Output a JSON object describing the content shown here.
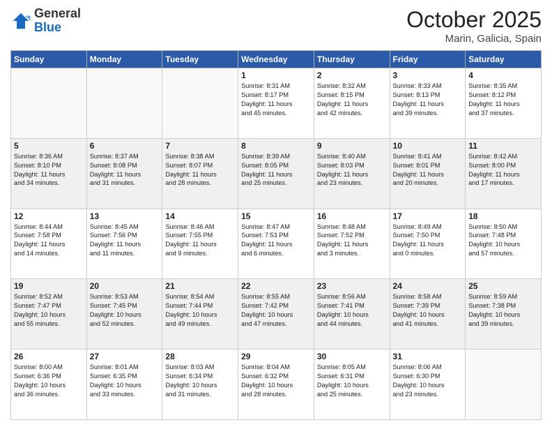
{
  "header": {
    "logo_general": "General",
    "logo_blue": "Blue",
    "month": "October 2025",
    "location": "Marin, Galicia, Spain"
  },
  "days_of_week": [
    "Sunday",
    "Monday",
    "Tuesday",
    "Wednesday",
    "Thursday",
    "Friday",
    "Saturday"
  ],
  "weeks": [
    [
      {
        "day": "",
        "info": []
      },
      {
        "day": "",
        "info": []
      },
      {
        "day": "",
        "info": []
      },
      {
        "day": "1",
        "info": [
          "Sunrise: 8:31 AM",
          "Sunset: 8:17 PM",
          "Daylight: 11 hours",
          "and 45 minutes."
        ]
      },
      {
        "day": "2",
        "info": [
          "Sunrise: 8:32 AM",
          "Sunset: 8:15 PM",
          "Daylight: 11 hours",
          "and 42 minutes."
        ]
      },
      {
        "day": "3",
        "info": [
          "Sunrise: 8:33 AM",
          "Sunset: 8:13 PM",
          "Daylight: 11 hours",
          "and 39 minutes."
        ]
      },
      {
        "day": "4",
        "info": [
          "Sunrise: 8:35 AM",
          "Sunset: 8:12 PM",
          "Daylight: 11 hours",
          "and 37 minutes."
        ]
      }
    ],
    [
      {
        "day": "5",
        "info": [
          "Sunrise: 8:36 AM",
          "Sunset: 8:10 PM",
          "Daylight: 11 hours",
          "and 34 minutes."
        ]
      },
      {
        "day": "6",
        "info": [
          "Sunrise: 8:37 AM",
          "Sunset: 8:08 PM",
          "Daylight: 11 hours",
          "and 31 minutes."
        ]
      },
      {
        "day": "7",
        "info": [
          "Sunrise: 8:38 AM",
          "Sunset: 8:07 PM",
          "Daylight: 11 hours",
          "and 28 minutes."
        ]
      },
      {
        "day": "8",
        "info": [
          "Sunrise: 8:39 AM",
          "Sunset: 8:05 PM",
          "Daylight: 11 hours",
          "and 25 minutes."
        ]
      },
      {
        "day": "9",
        "info": [
          "Sunrise: 8:40 AM",
          "Sunset: 8:03 PM",
          "Daylight: 11 hours",
          "and 23 minutes."
        ]
      },
      {
        "day": "10",
        "info": [
          "Sunrise: 8:41 AM",
          "Sunset: 8:01 PM",
          "Daylight: 11 hours",
          "and 20 minutes."
        ]
      },
      {
        "day": "11",
        "info": [
          "Sunrise: 8:42 AM",
          "Sunset: 8:00 PM",
          "Daylight: 11 hours",
          "and 17 minutes."
        ]
      }
    ],
    [
      {
        "day": "12",
        "info": [
          "Sunrise: 8:44 AM",
          "Sunset: 7:58 PM",
          "Daylight: 11 hours",
          "and 14 minutes."
        ]
      },
      {
        "day": "13",
        "info": [
          "Sunrise: 8:45 AM",
          "Sunset: 7:56 PM",
          "Daylight: 11 hours",
          "and 11 minutes."
        ]
      },
      {
        "day": "14",
        "info": [
          "Sunrise: 8:46 AM",
          "Sunset: 7:55 PM",
          "Daylight: 11 hours",
          "and 9 minutes."
        ]
      },
      {
        "day": "15",
        "info": [
          "Sunrise: 8:47 AM",
          "Sunset: 7:53 PM",
          "Daylight: 11 hours",
          "and 6 minutes."
        ]
      },
      {
        "day": "16",
        "info": [
          "Sunrise: 8:48 AM",
          "Sunset: 7:52 PM",
          "Daylight: 11 hours",
          "and 3 minutes."
        ]
      },
      {
        "day": "17",
        "info": [
          "Sunrise: 8:49 AM",
          "Sunset: 7:50 PM",
          "Daylight: 11 hours",
          "and 0 minutes."
        ]
      },
      {
        "day": "18",
        "info": [
          "Sunrise: 8:50 AM",
          "Sunset: 7:48 PM",
          "Daylight: 10 hours",
          "and 57 minutes."
        ]
      }
    ],
    [
      {
        "day": "19",
        "info": [
          "Sunrise: 8:52 AM",
          "Sunset: 7:47 PM",
          "Daylight: 10 hours",
          "and 55 minutes."
        ]
      },
      {
        "day": "20",
        "info": [
          "Sunrise: 8:53 AM",
          "Sunset: 7:45 PM",
          "Daylight: 10 hours",
          "and 52 minutes."
        ]
      },
      {
        "day": "21",
        "info": [
          "Sunrise: 8:54 AM",
          "Sunset: 7:44 PM",
          "Daylight: 10 hours",
          "and 49 minutes."
        ]
      },
      {
        "day": "22",
        "info": [
          "Sunrise: 8:55 AM",
          "Sunset: 7:42 PM",
          "Daylight: 10 hours",
          "and 47 minutes."
        ]
      },
      {
        "day": "23",
        "info": [
          "Sunrise: 8:56 AM",
          "Sunset: 7:41 PM",
          "Daylight: 10 hours",
          "and 44 minutes."
        ]
      },
      {
        "day": "24",
        "info": [
          "Sunrise: 8:58 AM",
          "Sunset: 7:39 PM",
          "Daylight: 10 hours",
          "and 41 minutes."
        ]
      },
      {
        "day": "25",
        "info": [
          "Sunrise: 8:59 AM",
          "Sunset: 7:38 PM",
          "Daylight: 10 hours",
          "and 39 minutes."
        ]
      }
    ],
    [
      {
        "day": "26",
        "info": [
          "Sunrise: 8:00 AM",
          "Sunset: 6:36 PM",
          "Daylight: 10 hours",
          "and 36 minutes."
        ]
      },
      {
        "day": "27",
        "info": [
          "Sunrise: 8:01 AM",
          "Sunset: 6:35 PM",
          "Daylight: 10 hours",
          "and 33 minutes."
        ]
      },
      {
        "day": "28",
        "info": [
          "Sunrise: 8:03 AM",
          "Sunset: 6:34 PM",
          "Daylight: 10 hours",
          "and 31 minutes."
        ]
      },
      {
        "day": "29",
        "info": [
          "Sunrise: 8:04 AM",
          "Sunset: 6:32 PM",
          "Daylight: 10 hours",
          "and 28 minutes."
        ]
      },
      {
        "day": "30",
        "info": [
          "Sunrise: 8:05 AM",
          "Sunset: 6:31 PM",
          "Daylight: 10 hours",
          "and 25 minutes."
        ]
      },
      {
        "day": "31",
        "info": [
          "Sunrise: 8:06 AM",
          "Sunset: 6:30 PM",
          "Daylight: 10 hours",
          "and 23 minutes."
        ]
      },
      {
        "day": "",
        "info": []
      }
    ]
  ]
}
